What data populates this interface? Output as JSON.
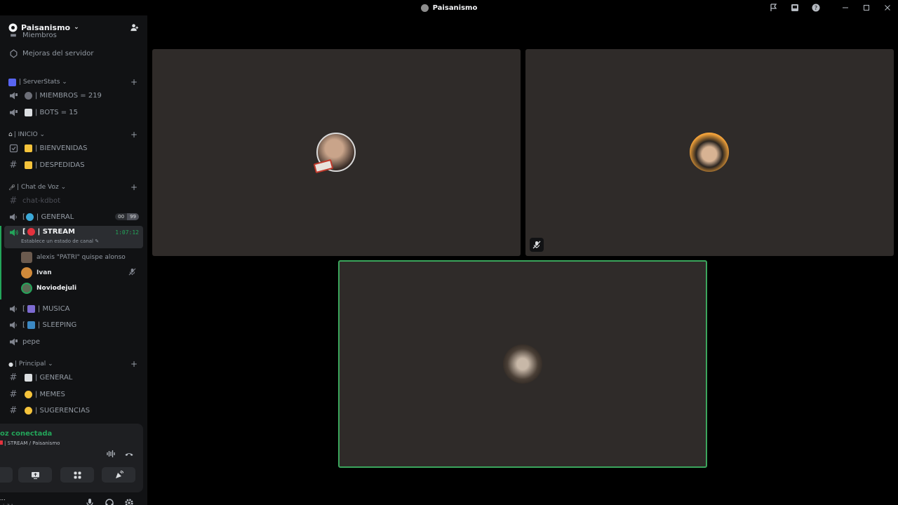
{
  "window": {
    "title": "Paisanismo"
  },
  "server": {
    "name": "Paisanismo",
    "partial_item": "Miembros",
    "boosts": "Mejoras del servidor"
  },
  "categories": {
    "serverstats": "| ServerStats",
    "inicio": "| INICIO",
    "chat_de_voz": "| Chat de Voz",
    "principal": "| Principal"
  },
  "channels": {
    "miembros": "| MIEMBROS = 219",
    "bots": "| BOTS = 15",
    "bienvenidas": "| BIENVENIDAS",
    "despedidas": "| DESPEDIDAS",
    "chat_kdbot": "chat-kdbot",
    "general_voice": "| GENERAL",
    "general_voice_prefix": "[",
    "general_count_a": "00",
    "general_count_b": "99",
    "stream_prefix": "[",
    "stream": "| STREAM",
    "stream_timer": "1:07:12",
    "stream_status": "Establece un estado de canal",
    "musica_prefix": "[",
    "musica": "| MUSICA",
    "sleeping_prefix": "[",
    "sleeping": "| SLEEPING",
    "pepe": "pepe",
    "general_text": "| GENERAL",
    "memes": "| MEMES",
    "sugerencias": "| SUGERENCIAS"
  },
  "voice_users": [
    {
      "name": "alexis \"PATRI\" quispe alonso"
    },
    {
      "name": "Ivan"
    },
    {
      "name": "Noviodejuli"
    }
  ],
  "voice_panel": {
    "status": "oz conectada",
    "channel": "| STREAM / Paisanismo"
  },
  "user_panel": {
    "name": "...",
    "status": "visible"
  },
  "colors": {
    "connected_green": "#23a55a",
    "speaking_border": "#3ba55c",
    "tile_bg": "#2f2b29",
    "sidebar_bg": "#111214"
  }
}
